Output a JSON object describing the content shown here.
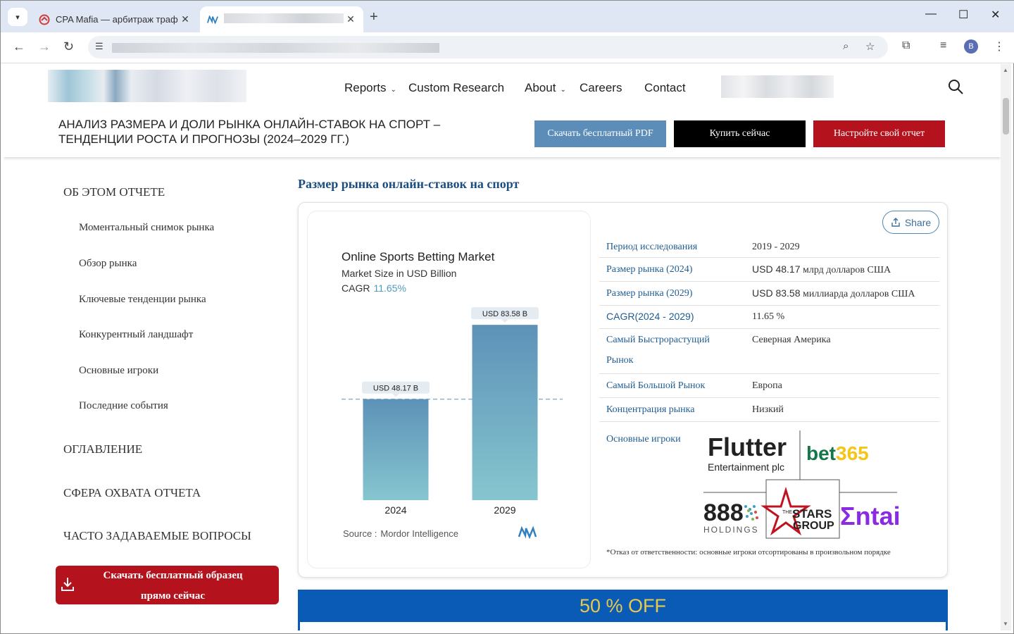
{
  "browser": {
    "tabs": [
      {
        "title": "CPA Mafia — арбитраж трафи",
        "active": false
      },
      {
        "title": "",
        "active": true
      }
    ],
    "avatar_letter": "B"
  },
  "site": {
    "nav": [
      {
        "label": "Reports",
        "dropdown": true
      },
      {
        "label": "Custom Research",
        "dropdown": false
      },
      {
        "label": "About",
        "dropdown": true
      },
      {
        "label": "Careers",
        "dropdown": false
      },
      {
        "label": "Contact",
        "dropdown": false
      }
    ],
    "report_title": "АНАЛИЗ РАЗМЕРА И ДОЛИ РЫНКА ОНЛАЙН-СТАВОК НА СПОРТ – ТЕНДЕНЦИИ РОСТА И ПРОГНОЗЫ (2024–2029 ГГ.)",
    "buttons": {
      "pdf": "Скачать бесплатный PDF",
      "buy": "Купить сейчас",
      "custom": "Настройте свой отчет"
    }
  },
  "sidebar": {
    "about_heading": "ОБ ЭТОМ ОТЧЕТЕ",
    "items": [
      "Моментальный снимок рынка",
      "Обзор рынка",
      "Ключевые тенденции рынка",
      "Конкурентный ландшафт",
      "Основные игроки",
      "Последние события"
    ],
    "toc_heading": "ОГЛАВЛЕНИЕ",
    "scope_heading": "СФЕРА ОХВАТА ОТЧЕТА",
    "faq_heading": "ЧАСТО ЗАДАВАЕМЫЕ ВОПРОСЫ",
    "sample_button_line1": "Скачать бесплатный образец",
    "sample_button_line2": "прямо сейчас"
  },
  "main": {
    "section_title": "Размер рынка онлайн-ставок на спорт",
    "share_label": "Share",
    "info": [
      {
        "key": "Период исследования",
        "value": "2019 - 2029"
      },
      {
        "key": "Размер рынка (2024)",
        "value_num": "USD 48.17",
        "value_text": " млрд долларов США"
      },
      {
        "key": "Размер рынка (2029)",
        "value_num": "USD 83.58",
        "value_text": " миллиарда долларов США"
      },
      {
        "key": "CAGR(2024 - 2029)",
        "value": "11.65 %"
      },
      {
        "key": "Самый Быстрорастущий Рынок",
        "value": "Северная Америка"
      },
      {
        "key": "Самый Большой Рынок",
        "value": "Европа"
      },
      {
        "key": "Концентрация рынка",
        "value": "Низкий"
      }
    ],
    "players_label": "Основные игроки",
    "players": {
      "flutter_1": "Flutter",
      "flutter_2": "Entertainment plc",
      "bet365_a": "bet",
      "bet365_b": "365",
      "p888_a": "888",
      "p888_b": "HOLDINGS",
      "stars_small": "THE",
      "stars_1": "STARS",
      "stars_2": "GROUP",
      "entain": "Σntain"
    },
    "disclaimer": "*Отказ от ответственности: основные игроки отсортированы в произвольном порядке",
    "promo": "50 % OFF"
  },
  "chart_data": {
    "type": "bar",
    "title": "Online Sports Betting Market",
    "subtitle": "Market Size in USD Billion",
    "cagr_label": "CAGR",
    "cagr_value": "11.65%",
    "categories": [
      "2024",
      "2029"
    ],
    "values": [
      48.17,
      83.58
    ],
    "data_labels": [
      "USD 48.17 B",
      "USD 83.58 B"
    ],
    "source_label": "Source :",
    "source": "Mordor Intelligence",
    "ylim": [
      0,
      88
    ],
    "colors": {
      "bar_top": "#5d92b8",
      "bar_bottom": "#86c6cf",
      "cagr": "#4f9bbd"
    }
  }
}
